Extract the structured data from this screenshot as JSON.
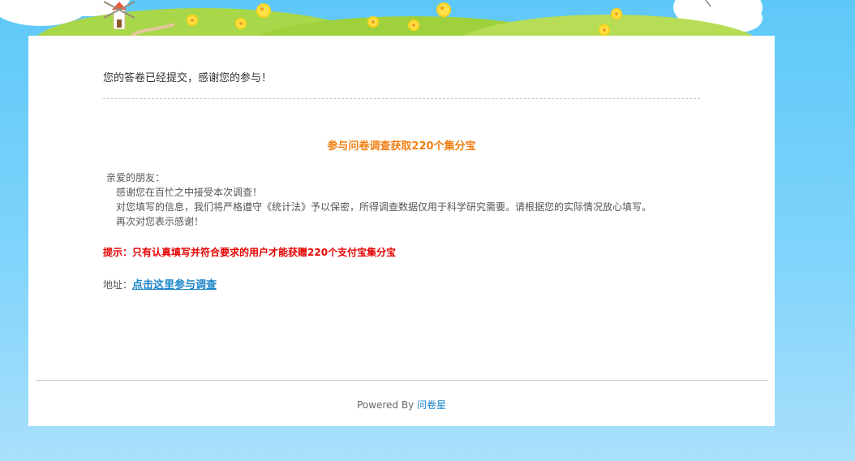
{
  "message": {
    "intro": "您的答卷已经提交，感谢您的参与！"
  },
  "survey": {
    "title": "参与问卷调查获取220个集分宝",
    "greeting": "亲爱的朋友：",
    "lines": [
      "感谢您在百忙之中接受本次调查！",
      "对您填写的信息，我们将严格遵守《统计法》予以保密，所得调查数据仅用于科学研究需要。请根据您的实际情况放心填写。",
      "再次对您表示感谢！"
    ],
    "tip": "提示：只有认真填写并符合要求的用户才能获赠220个支付宝集分宝",
    "address_label": "地址：",
    "address_link": "点击这里参与调查"
  },
  "footer": {
    "powered_by": "Powered By ",
    "brand": "问卷星"
  },
  "colors": {
    "title": "#f27f12",
    "tip": "#e60000",
    "link": "#1a84c9",
    "background": "#7fd4fb"
  }
}
